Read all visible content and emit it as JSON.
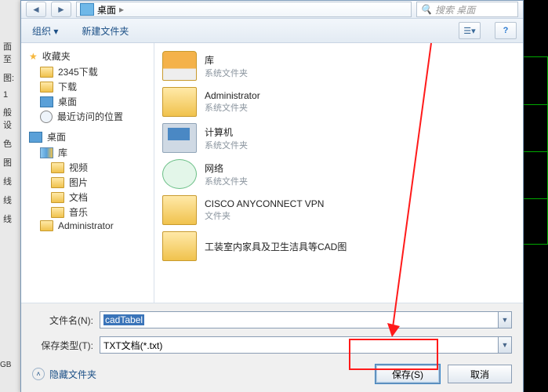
{
  "crumb_location": "桌面",
  "crumb_glyph": "▸",
  "search_placeholder": "搜索 桌面",
  "toolbar": {
    "organize": "组织 ▾",
    "new_folder": "新建文件夹",
    "help_glyph": "?"
  },
  "tree": {
    "favorites": "收藏夹",
    "fav_items": [
      "2345下载",
      "下载",
      "桌面",
      "最近访问的位置"
    ],
    "desktop": "桌面",
    "library": "库",
    "lib_items": [
      "视频",
      "图片",
      "文档",
      "音乐"
    ],
    "admin": "Administrator"
  },
  "list_items": [
    {
      "title": "库",
      "sub": "系统文件夹",
      "icon": "lib-big"
    },
    {
      "title": "Administrator",
      "sub": "系统文件夹",
      "icon": "folder-big"
    },
    {
      "title": "计算机",
      "sub": "系统文件夹",
      "icon": "pc-big"
    },
    {
      "title": "网络",
      "sub": "系统文件夹",
      "icon": "net-big"
    },
    {
      "title": "CISCO ANYCONNECT VPN",
      "sub": "文件夹",
      "icon": "folder-big"
    },
    {
      "title": "工装室内家具及卫生洁具等CAD图",
      "sub": "",
      "icon": "folder-big"
    }
  ],
  "filename_label": "文件名(N):",
  "filename_value": "cadTabel",
  "filetype_label": "保存类型(T):",
  "filetype_value": "TXT文档(*.txt)",
  "hide_folders": "隐藏文件夹",
  "save_btn": "保存(S)",
  "cancel_btn": "取消",
  "host_left": [
    "面至",
    "图:",
    "1",
    "般设",
    "色",
    "图",
    "线",
    "线",
    "线"
  ],
  "host_bottom": "GB"
}
